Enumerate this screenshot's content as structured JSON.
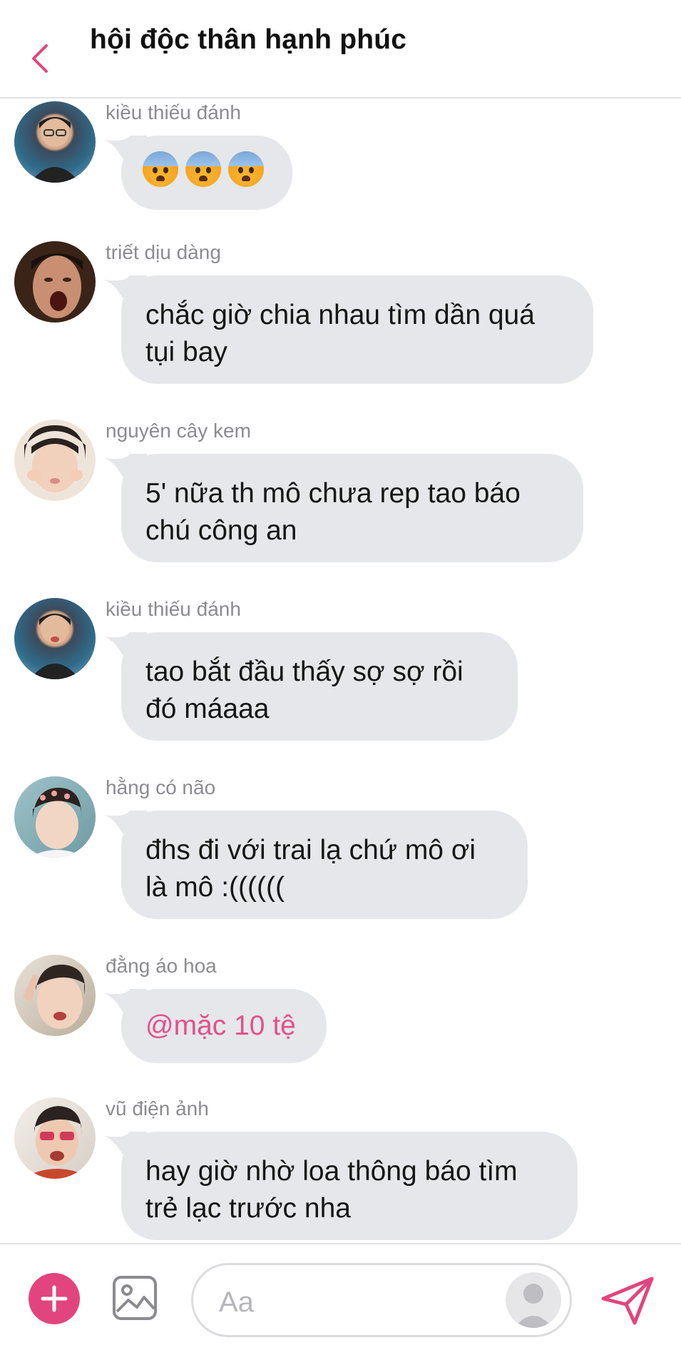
{
  "header": {
    "title": "hội độc thân hạnh phúc",
    "back_icon": "chevron-left-icon",
    "accent_color": "#e2457d"
  },
  "messages": [
    {
      "sender": "kiều thiếu đánh",
      "type": "emoji",
      "emojis": [
        "anxious-face-emoji",
        "anxious-face-emoji",
        "anxious-face-emoji"
      ]
    },
    {
      "sender": "triết dịu dàng",
      "text": "chắc giờ chia nhau tìm dần quá\ntụi bay"
    },
    {
      "sender": "nguyên cây kem",
      "text": "5' nữa th mô chưa rep tao báo\nchú công an"
    },
    {
      "sender": "kiều thiếu đánh",
      "text": "tao bắt đầu thấy sợ sợ rồi\nđó máaaa"
    },
    {
      "sender": "hằng có não",
      "text": "đhs đi với trai lạ chứ mô ơi\nlà mô :(((((("
    },
    {
      "sender": "đằng áo hoa",
      "text": "@mặc 10 tệ",
      "mention": true
    },
    {
      "sender": "vũ điện ảnh",
      "text": "hay giờ nhờ loa thông báo tìm\ntrẻ lạc trước nha"
    }
  ],
  "composer": {
    "placeholder": "Aa",
    "plus_icon": "plus-icon",
    "image_icon": "image-icon",
    "send_icon": "send-icon"
  }
}
